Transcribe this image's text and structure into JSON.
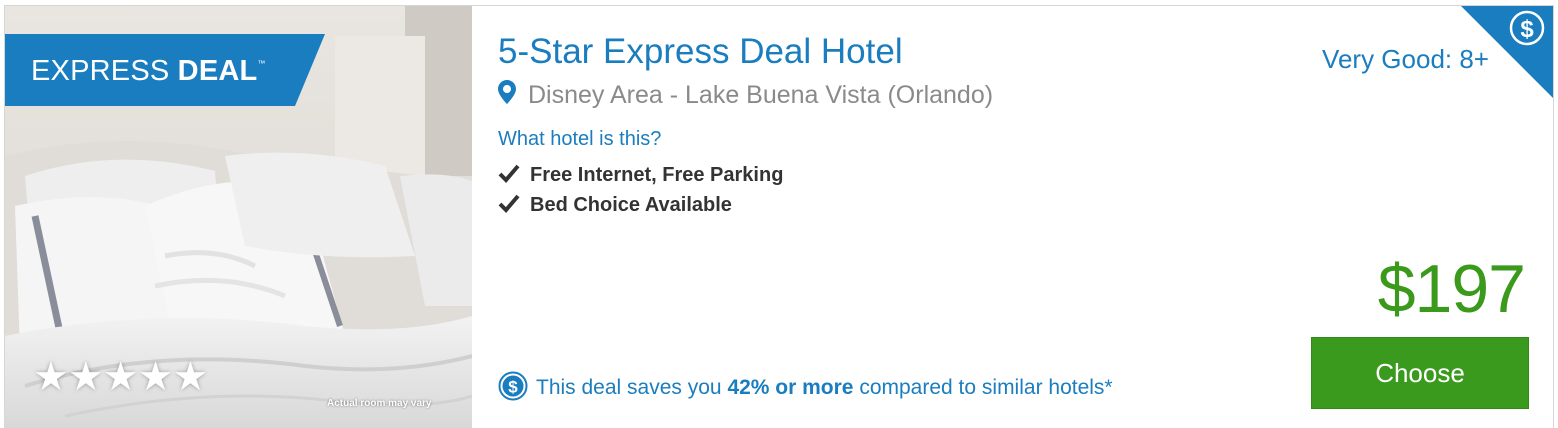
{
  "deal": {
    "badge_part1": "EXPRESS ",
    "badge_part2": "DEAL",
    "badge_tm": "™",
    "stars": "★★★★★",
    "star_rating": 5,
    "room_note": "Actual room may vary",
    "title": "5-Star Express Deal Hotel",
    "location": "Disney Area - Lake Buena Vista (Orlando)",
    "what_hotel_link": "What hotel is this?",
    "features": [
      "Free Internet, Free Parking",
      "Bed Choice Available"
    ],
    "rating": "Very Good: 8+",
    "corner_symbol": "$",
    "price": "$197",
    "choose_label": "Choose",
    "savings_prefix": "This deal saves you ",
    "savings_bold": "42% or more",
    "savings_suffix": " compared to similar hotels*",
    "savings_symbol": "$"
  },
  "icons": [
    "pin-icon",
    "check-icon",
    "dollar-coin-icon",
    "dollar-corner-icon",
    "star-icon"
  ],
  "colors": {
    "brand_blue": "#1a7dbf",
    "price_green": "#3b9a1c",
    "button_green": "#3a9a1e",
    "text_dark": "#333333",
    "text_gray": "#8a8a8a"
  }
}
